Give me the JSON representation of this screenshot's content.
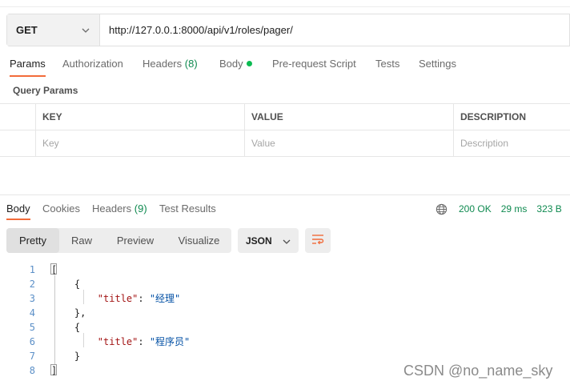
{
  "request": {
    "method": "GET",
    "url": "http://127.0.0.1:8000/api/v1/roles/pager/"
  },
  "request_tabs": [
    {
      "label": "Params",
      "count": "",
      "active": true
    },
    {
      "label": "Authorization",
      "count": "",
      "active": false
    },
    {
      "label": "Headers",
      "count": "(8)",
      "active": false
    },
    {
      "label": "Body",
      "count": "",
      "active": false,
      "dot": true
    },
    {
      "label": "Pre-request Script",
      "count": "",
      "active": false
    },
    {
      "label": "Tests",
      "count": "",
      "active": false
    },
    {
      "label": "Settings",
      "count": "",
      "active": false
    }
  ],
  "query_params": {
    "title": "Query Params",
    "columns": [
      "KEY",
      "VALUE",
      "DESCRIPTION"
    ],
    "placeholders": [
      "Key",
      "Value",
      "Description"
    ]
  },
  "response_tabs": [
    {
      "label": "Body",
      "count": "",
      "active": true
    },
    {
      "label": "Cookies",
      "count": "",
      "active": false
    },
    {
      "label": "Headers",
      "count": "(9)",
      "active": false
    },
    {
      "label": "Test Results",
      "count": "",
      "active": false
    }
  ],
  "status": {
    "code": "200 OK",
    "time": "29 ms",
    "size": "323 B"
  },
  "view_modes": [
    "Pretty",
    "Raw",
    "Preview",
    "Visualize"
  ],
  "active_view_mode": "Pretty",
  "format": "JSON",
  "code_lines": [
    {
      "n": "1",
      "parts": [
        [
          "p",
          "["
        ]
      ]
    },
    {
      "n": "2",
      "parts": [
        [
          "p",
          "    {"
        ]
      ]
    },
    {
      "n": "3",
      "parts": [
        [
          "p",
          "        "
        ],
        [
          "k",
          "\"title\""
        ],
        [
          "p",
          ": "
        ],
        [
          "s",
          "\"经理\""
        ]
      ]
    },
    {
      "n": "4",
      "parts": [
        [
          "p",
          "    },"
        ]
      ]
    },
    {
      "n": "5",
      "parts": [
        [
          "p",
          "    {"
        ]
      ]
    },
    {
      "n": "6",
      "parts": [
        [
          "p",
          "        "
        ],
        [
          "k",
          "\"title\""
        ],
        [
          "p",
          ": "
        ],
        [
          "s",
          "\"程序员\""
        ]
      ]
    },
    {
      "n": "7",
      "parts": [
        [
          "p",
          "    }"
        ]
      ]
    },
    {
      "n": "8",
      "parts": [
        [
          "p",
          "]"
        ]
      ]
    }
  ],
  "watermark": "CSDN @no_name_sky",
  "colors": {
    "accent": "#f26b3a",
    "status_green": "#0f8a50",
    "dot_green": "#0cbb52",
    "json_key": "#a31515",
    "json_string": "#0451a5",
    "line_number": "#5b8fc7"
  },
  "icons": {
    "method_dropdown": "chevron-down-icon",
    "format_dropdown": "chevron-down-icon",
    "network": "globe-icon",
    "wrap": "wrap-lines-icon"
  }
}
